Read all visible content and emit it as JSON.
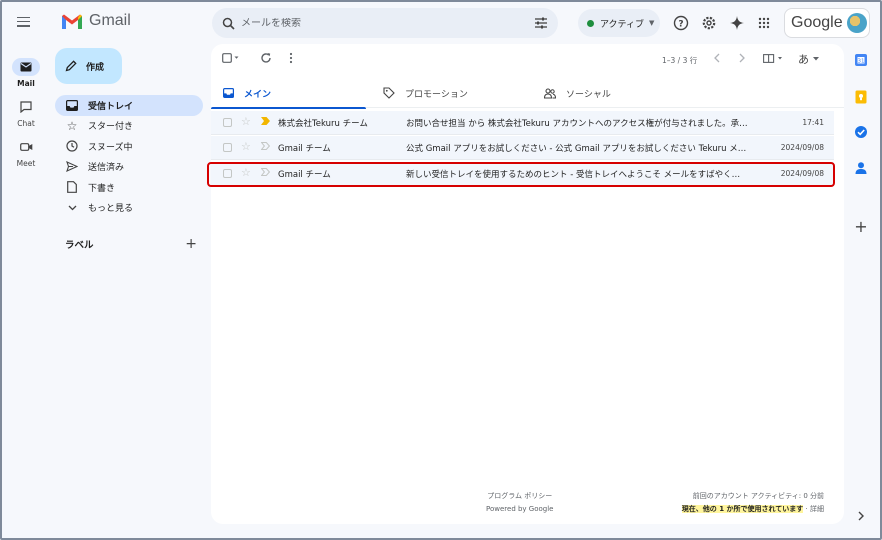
{
  "header": {
    "brand": "Gmail",
    "search_placeholder": "メールを検索",
    "status_label": "アクティブ",
    "google_label": "Google"
  },
  "rail": {
    "items": [
      {
        "label": "Mail"
      },
      {
        "label": "Chat"
      },
      {
        "label": "Meet"
      }
    ]
  },
  "compose_label": "作成",
  "nav": {
    "items": [
      {
        "label": "受信トレイ"
      },
      {
        "label": "スター付き"
      },
      {
        "label": "スヌーズ中"
      },
      {
        "label": "送信済み"
      },
      {
        "label": "下書き"
      },
      {
        "label": "もっと見る"
      }
    ],
    "labels_title": "ラベル"
  },
  "toolbar": {
    "pager": "1–3 / 3 行",
    "input_tool": "あ"
  },
  "tabs": [
    {
      "label": "メイン"
    },
    {
      "label": "プロモーション"
    },
    {
      "label": "ソーシャル"
    }
  ],
  "emails": [
    {
      "sender": "株式会社Tekuru チーム",
      "subject": "お問い合せ担当 から 株式会社Tekuru アカウントへのアクセス権が付与されました。承…",
      "date": "17:41",
      "important": true
    },
    {
      "sender": "Gmail チーム",
      "subject": "公式 Gmail アプリをお試しください - 公式 Gmail アプリをお試しください Tekuru メ…",
      "date": "2024/09/08",
      "important": false
    },
    {
      "sender": "Gmail チーム",
      "subject": "新しい受信トレイを使用するためのヒント - 受信トレイへようこそ メールをすばやく…",
      "date": "2024/09/08",
      "important": false
    }
  ],
  "footer": {
    "program_policy": "プログラム ポリシー",
    "powered_by": "Powered by Google",
    "last_activity": "前回のアカウント アクティビティ: 0 分前",
    "current_use": "現在、他の 1 か所で使用されています",
    "details": "· 詳細"
  },
  "colors": {
    "accent": "#0b57d0",
    "active_nav_bg": "#d3e3fd",
    "compose_bg": "#c2e7ff",
    "highlight_border": "#d60000"
  }
}
